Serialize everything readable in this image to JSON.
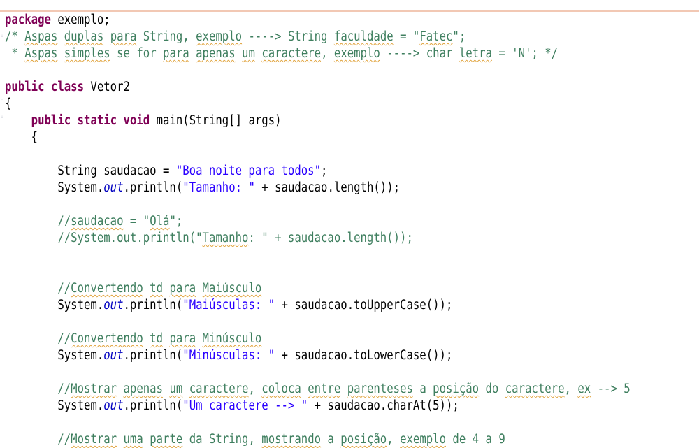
{
  "editor": {
    "lines": [
      {
        "parts": [
          {
            "t": "package",
            "c": "kw"
          },
          {
            "t": " exemplo;",
            "c": "plain"
          }
        ]
      },
      {
        "parts": [
          {
            "t": "/* ",
            "c": "cm"
          },
          {
            "t": "Aspas",
            "c": "cm sq"
          },
          {
            "t": " ",
            "c": "cm"
          },
          {
            "t": "duplas",
            "c": "cm sq"
          },
          {
            "t": " ",
            "c": "cm"
          },
          {
            "t": "para",
            "c": "cm sq"
          },
          {
            "t": " String, ",
            "c": "cm"
          },
          {
            "t": "exemplo",
            "c": "cm sq"
          },
          {
            "t": " ----> String ",
            "c": "cm"
          },
          {
            "t": "faculdade",
            "c": "cm sq"
          },
          {
            "t": " = \"",
            "c": "cm"
          },
          {
            "t": "Fatec",
            "c": "cm sq"
          },
          {
            "t": "\";",
            "c": "cm"
          }
        ]
      },
      {
        "parts": [
          {
            "t": " * ",
            "c": "cm"
          },
          {
            "t": "Aspas",
            "c": "cm sq"
          },
          {
            "t": " ",
            "c": "cm"
          },
          {
            "t": "simples",
            "c": "cm sq"
          },
          {
            "t": " se for ",
            "c": "cm"
          },
          {
            "t": "para",
            "c": "cm sq"
          },
          {
            "t": " ",
            "c": "cm"
          },
          {
            "t": "apenas",
            "c": "cm sq"
          },
          {
            "t": " ",
            "c": "cm"
          },
          {
            "t": "um",
            "c": "cm sq"
          },
          {
            "t": " ",
            "c": "cm"
          },
          {
            "t": "caractere",
            "c": "cm sq"
          },
          {
            "t": ", ",
            "c": "cm"
          },
          {
            "t": "exemplo",
            "c": "cm sq"
          },
          {
            "t": " ----> char ",
            "c": "cm"
          },
          {
            "t": "letra",
            "c": "cm sq"
          },
          {
            "t": " = 'N'; */",
            "c": "cm"
          }
        ]
      },
      {
        "parts": []
      },
      {
        "parts": [
          {
            "t": "public",
            "c": "kw"
          },
          {
            "t": " ",
            "c": "plain"
          },
          {
            "t": "class",
            "c": "kw"
          },
          {
            "t": " Vetor2",
            "c": "plain"
          }
        ]
      },
      {
        "parts": [
          {
            "t": "{",
            "c": "plain"
          }
        ]
      },
      {
        "parts": [
          {
            "t": "    ",
            "c": "plain"
          },
          {
            "t": "public",
            "c": "kw"
          },
          {
            "t": " ",
            "c": "plain"
          },
          {
            "t": "static",
            "c": "kw"
          },
          {
            "t": " ",
            "c": "plain"
          },
          {
            "t": "void",
            "c": "kw"
          },
          {
            "t": " main(String[] args)",
            "c": "plain"
          }
        ]
      },
      {
        "parts": [
          {
            "t": "    {",
            "c": "plain"
          }
        ]
      },
      {
        "parts": []
      },
      {
        "parts": [
          {
            "t": "        String saudacao = ",
            "c": "plain"
          },
          {
            "t": "\"Boa noite para todos\"",
            "c": "st"
          },
          {
            "t": ";",
            "c": "plain"
          }
        ]
      },
      {
        "parts": [
          {
            "t": "        System.",
            "c": "plain"
          },
          {
            "t": "out",
            "c": "fld"
          },
          {
            "t": ".println(",
            "c": "plain"
          },
          {
            "t": "\"Tamanho: \"",
            "c": "st"
          },
          {
            "t": " + saudacao.length());",
            "c": "plain"
          }
        ]
      },
      {
        "parts": []
      },
      {
        "parts": [
          {
            "t": "        //",
            "c": "cm"
          },
          {
            "t": "saudacao",
            "c": "cm sq"
          },
          {
            "t": " = \"",
            "c": "cm"
          },
          {
            "t": "Olá",
            "c": "cm sq"
          },
          {
            "t": "\";",
            "c": "cm"
          }
        ]
      },
      {
        "parts": [
          {
            "t": "        //System.out.println(\"",
            "c": "cm"
          },
          {
            "t": "Tamanho",
            "c": "cm sq"
          },
          {
            "t": ": \" + saudacao.length());",
            "c": "cm"
          }
        ]
      },
      {
        "parts": []
      },
      {
        "parts": []
      },
      {
        "parts": [
          {
            "t": "        //",
            "c": "cm"
          },
          {
            "t": "Convertendo",
            "c": "cm sq"
          },
          {
            "t": " ",
            "c": "cm"
          },
          {
            "t": "td",
            "c": "cm sq"
          },
          {
            "t": " ",
            "c": "cm"
          },
          {
            "t": "para",
            "c": "cm sq"
          },
          {
            "t": " ",
            "c": "cm"
          },
          {
            "t": "Maiúsculo",
            "c": "cm sq"
          }
        ]
      },
      {
        "parts": [
          {
            "t": "        System.",
            "c": "plain"
          },
          {
            "t": "out",
            "c": "fld"
          },
          {
            "t": ".println(",
            "c": "plain"
          },
          {
            "t": "\"Maiúsculas: \"",
            "c": "st"
          },
          {
            "t": " + saudacao.toUpperCase());",
            "c": "plain"
          }
        ]
      },
      {
        "parts": []
      },
      {
        "parts": [
          {
            "t": "        //",
            "c": "cm"
          },
          {
            "t": "Convertendo",
            "c": "cm sq"
          },
          {
            "t": " ",
            "c": "cm"
          },
          {
            "t": "td",
            "c": "cm sq"
          },
          {
            "t": " ",
            "c": "cm"
          },
          {
            "t": "para",
            "c": "cm sq"
          },
          {
            "t": " ",
            "c": "cm"
          },
          {
            "t": "Minúsculo",
            "c": "cm sq"
          }
        ]
      },
      {
        "parts": [
          {
            "t": "        System.",
            "c": "plain"
          },
          {
            "t": "out",
            "c": "fld"
          },
          {
            "t": ".println(",
            "c": "plain"
          },
          {
            "t": "\"Minúsculas: \"",
            "c": "st"
          },
          {
            "t": " + saudacao.toLowerCase());",
            "c": "plain"
          }
        ]
      },
      {
        "parts": []
      },
      {
        "parts": [
          {
            "t": "        //",
            "c": "cm"
          },
          {
            "t": "Mostrar",
            "c": "cm sq"
          },
          {
            "t": " ",
            "c": "cm"
          },
          {
            "t": "apenas",
            "c": "cm sq"
          },
          {
            "t": " ",
            "c": "cm"
          },
          {
            "t": "um",
            "c": "cm sq"
          },
          {
            "t": " ",
            "c": "cm"
          },
          {
            "t": "caractere",
            "c": "cm sq"
          },
          {
            "t": ", ",
            "c": "cm"
          },
          {
            "t": "coloca",
            "c": "cm sq"
          },
          {
            "t": " ",
            "c": "cm"
          },
          {
            "t": "entre",
            "c": "cm sq"
          },
          {
            "t": " ",
            "c": "cm"
          },
          {
            "t": "parenteses",
            "c": "cm sq"
          },
          {
            "t": " a ",
            "c": "cm"
          },
          {
            "t": "posição",
            "c": "cm sq"
          },
          {
            "t": " do ",
            "c": "cm"
          },
          {
            "t": "caractere",
            "c": "cm sq"
          },
          {
            "t": ", ",
            "c": "cm"
          },
          {
            "t": "ex",
            "c": "cm sq"
          },
          {
            "t": " --> 5",
            "c": "cm"
          }
        ]
      },
      {
        "parts": [
          {
            "t": "        System.",
            "c": "plain"
          },
          {
            "t": "out",
            "c": "fld"
          },
          {
            "t": ".println(",
            "c": "plain"
          },
          {
            "t": "\"Um caractere --> \"",
            "c": "st"
          },
          {
            "t": " + saudacao.charAt(5));",
            "c": "plain"
          }
        ]
      },
      {
        "parts": []
      },
      {
        "parts": [
          {
            "t": "        //",
            "c": "cm"
          },
          {
            "t": "Mostrar",
            "c": "cm sq"
          },
          {
            "t": " ",
            "c": "cm"
          },
          {
            "t": "uma",
            "c": "cm sq"
          },
          {
            "t": " ",
            "c": "cm"
          },
          {
            "t": "parte",
            "c": "cm sq"
          },
          {
            "t": " da String, ",
            "c": "cm"
          },
          {
            "t": "mostrando",
            "c": "cm sq"
          },
          {
            "t": " a ",
            "c": "cm"
          },
          {
            "t": "posição",
            "c": "cm sq"
          },
          {
            "t": ", ",
            "c": "cm"
          },
          {
            "t": "exemplo",
            "c": "cm sq"
          },
          {
            "t": " de 4 a 9",
            "c": "cm"
          }
        ]
      }
    ]
  }
}
